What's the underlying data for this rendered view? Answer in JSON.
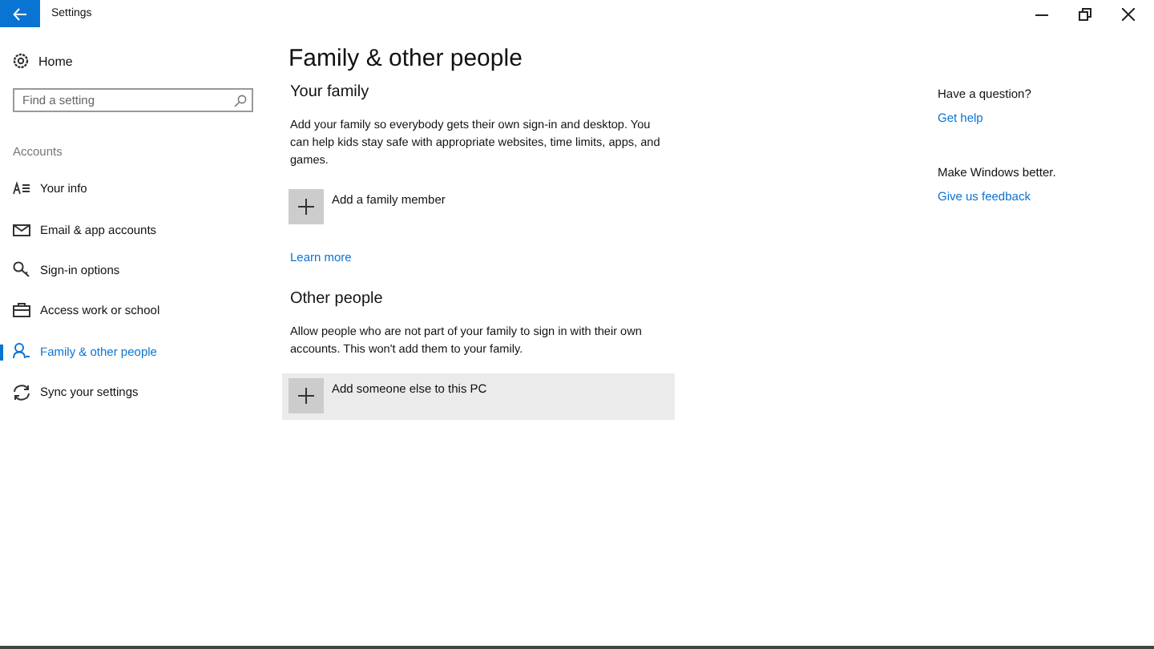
{
  "window": {
    "title": "Settings"
  },
  "sidebar": {
    "home": "Home",
    "search": {
      "placeholder": "Find a setting"
    },
    "section": "Accounts",
    "items": [
      {
        "label": "Your info",
        "kind": "info",
        "selected": false
      },
      {
        "label": "Email & app accounts",
        "kind": "mail",
        "selected": false
      },
      {
        "label": "Sign-in options",
        "kind": "key",
        "selected": false
      },
      {
        "label": "Access work or school",
        "kind": "briefcase",
        "selected": false
      },
      {
        "label": "Family & other people",
        "kind": "person",
        "selected": true
      },
      {
        "label": "Sync your settings",
        "kind": "sync",
        "selected": false
      }
    ]
  },
  "page": {
    "title": "Family & other people",
    "sections": [
      {
        "heading": "Your family",
        "text": "Add your family so everybody gets their own sign-in and desktop. You can help kids stay safe with appropriate websites, time limits, apps, and games.",
        "action": {
          "label": "Add a family member",
          "highlighted": false
        },
        "link": "Learn more"
      },
      {
        "heading": "Other people",
        "text": "Allow people who are not part of your family to sign in with their own accounts. This won't add them to your family.",
        "action": {
          "label": "Add someone else to this PC",
          "highlighted": true
        }
      }
    ]
  },
  "aside": [
    {
      "text": "Have a question?",
      "link": "Get help"
    },
    {
      "text": "Make Windows better.",
      "link": "Give us feedback"
    }
  ]
}
